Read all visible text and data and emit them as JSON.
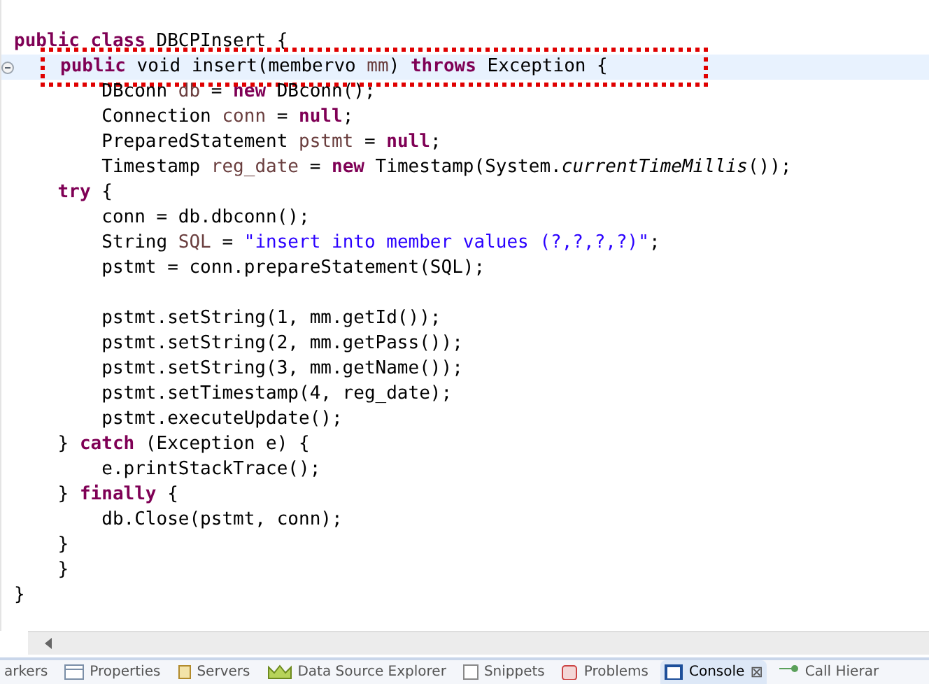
{
  "editor": {
    "lines": [
      {
        "current": false,
        "fold": false,
        "segments": [
          {
            "kind": "keyword",
            "text": "public class"
          },
          {
            "kind": "plain",
            "text": " DBCPInsert {"
          }
        ]
      },
      {
        "current": true,
        "fold": true,
        "segments": [
          {
            "kind": "keyword",
            "text": "    public"
          },
          {
            "kind": "plain",
            "text": " void insert(membervo "
          },
          {
            "kind": "field",
            "text": "mm"
          },
          {
            "kind": "plain",
            "text": ") "
          },
          {
            "kind": "keyword",
            "text": "throws"
          },
          {
            "kind": "plain",
            "text": " Exception {"
          }
        ]
      },
      {
        "current": false,
        "fold": false,
        "segments": [
          {
            "kind": "plain",
            "text": "        DBconn "
          },
          {
            "kind": "field",
            "text": "db"
          },
          {
            "kind": "plain",
            "text": " = "
          },
          {
            "kind": "keyword",
            "text": "new"
          },
          {
            "kind": "plain",
            "text": " DBconn();"
          }
        ]
      },
      {
        "current": false,
        "fold": false,
        "segments": [
          {
            "kind": "plain",
            "text": "        Connection "
          },
          {
            "kind": "field",
            "text": "conn"
          },
          {
            "kind": "plain",
            "text": " = "
          },
          {
            "kind": "keyword",
            "text": "null"
          },
          {
            "kind": "plain",
            "text": ";"
          }
        ]
      },
      {
        "current": false,
        "fold": false,
        "segments": [
          {
            "kind": "plain",
            "text": "        PreparedStatement "
          },
          {
            "kind": "field",
            "text": "pstmt"
          },
          {
            "kind": "plain",
            "text": " = "
          },
          {
            "kind": "keyword",
            "text": "null"
          },
          {
            "kind": "plain",
            "text": ";"
          }
        ]
      },
      {
        "current": false,
        "fold": false,
        "segments": [
          {
            "kind": "plain",
            "text": "        Timestamp "
          },
          {
            "kind": "field",
            "text": "reg_date"
          },
          {
            "kind": "plain",
            "text": " = "
          },
          {
            "kind": "keyword",
            "text": "new"
          },
          {
            "kind": "plain",
            "text": " Timestamp(System."
          },
          {
            "kind": "static",
            "text": "currentTimeMillis"
          },
          {
            "kind": "plain",
            "text": "());"
          }
        ]
      },
      {
        "current": false,
        "fold": false,
        "segments": [
          {
            "kind": "keyword",
            "text": "    try"
          },
          {
            "kind": "plain",
            "text": " {"
          }
        ]
      },
      {
        "current": false,
        "fold": false,
        "segments": [
          {
            "kind": "plain",
            "text": "        conn = db.dbconn();"
          }
        ]
      },
      {
        "current": false,
        "fold": false,
        "segments": [
          {
            "kind": "plain",
            "text": "        String "
          },
          {
            "kind": "field",
            "text": "SQL"
          },
          {
            "kind": "plain",
            "text": " = "
          },
          {
            "kind": "string",
            "text": "\"insert into member values (?,?,?,?)\""
          },
          {
            "kind": "plain",
            "text": ";"
          }
        ]
      },
      {
        "current": false,
        "fold": false,
        "segments": [
          {
            "kind": "plain",
            "text": "        pstmt = conn.prepareStatement(SQL);"
          }
        ]
      },
      {
        "current": false,
        "fold": false
      },
      {
        "current": false,
        "fold": false,
        "segments": [
          {
            "kind": "plain",
            "text": "        pstmt.setString(1, mm.getId());"
          }
        ]
      },
      {
        "current": false,
        "fold": false,
        "segments": [
          {
            "kind": "plain",
            "text": "        pstmt.setString(2, mm.getPass());"
          }
        ]
      },
      {
        "current": false,
        "fold": false,
        "segments": [
          {
            "kind": "plain",
            "text": "        pstmt.setString(3, mm.getName());"
          }
        ]
      },
      {
        "current": false,
        "fold": false,
        "segments": [
          {
            "kind": "plain",
            "text": "        pstmt.setTimestamp(4, reg_date);"
          }
        ]
      },
      {
        "current": false,
        "fold": false,
        "segments": [
          {
            "kind": "plain",
            "text": "        pstmt.executeUpdate();"
          }
        ]
      },
      {
        "current": false,
        "fold": false,
        "segments": [
          {
            "kind": "plain",
            "text": "    } "
          },
          {
            "kind": "keyword",
            "text": "catch"
          },
          {
            "kind": "plain",
            "text": " (Exception e) {"
          }
        ]
      },
      {
        "current": false,
        "fold": false,
        "segments": [
          {
            "kind": "plain",
            "text": "        e.printStackTrace();"
          }
        ]
      },
      {
        "current": false,
        "fold": false,
        "segments": [
          {
            "kind": "plain",
            "text": "    } "
          },
          {
            "kind": "keyword",
            "text": "finally"
          },
          {
            "kind": "plain",
            "text": " {"
          }
        ]
      },
      {
        "current": false,
        "fold": false,
        "segments": [
          {
            "kind": "plain",
            "text": "        db.Close(pstmt, conn);"
          }
        ]
      },
      {
        "current": false,
        "fold": false,
        "segments": [
          {
            "kind": "plain",
            "text": "    }"
          }
        ]
      },
      {
        "current": false,
        "fold": false,
        "segments": [
          {
            "kind": "plain",
            "text": "    }"
          }
        ]
      },
      {
        "current": false,
        "fold": false,
        "segments": [
          {
            "kind": "plain",
            "text": "}"
          }
        ]
      }
    ]
  },
  "view_tabs": [
    {
      "label": "arkers",
      "selected": false
    },
    {
      "label": "Properties",
      "selected": false
    },
    {
      "label": "Servers",
      "selected": false
    },
    {
      "label": "Data Source Explorer",
      "selected": false
    },
    {
      "label": "Snippets",
      "selected": false
    },
    {
      "label": "Problems",
      "selected": false
    },
    {
      "label": "Console",
      "selected": true,
      "close": "⊠"
    },
    {
      "label": "Call Hierar",
      "selected": false
    }
  ]
}
